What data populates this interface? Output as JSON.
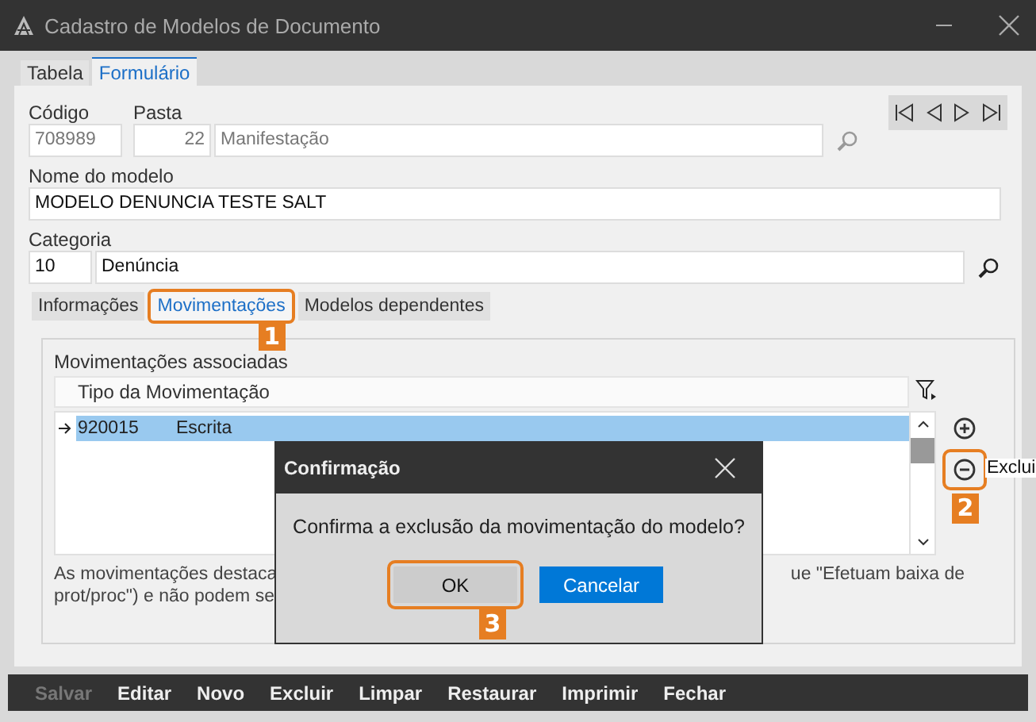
{
  "window": {
    "title": "Cadastro de Modelos de Documento"
  },
  "tabs": [
    {
      "label": "Tabela",
      "selected": false
    },
    {
      "label": "Formulário",
      "selected": true
    }
  ],
  "form": {
    "codigo_label": "Código",
    "codigo": "708989",
    "pasta_label": "Pasta",
    "pasta_code": "22",
    "pasta_name": "Manifestação",
    "nome_label": "Nome do modelo",
    "nome": "MODELO DENUNCIA TESTE SALT",
    "categoria_label": "Categoria",
    "categoria_code": "10",
    "categoria_name": "Denúncia"
  },
  "subtabs": [
    {
      "label": "Informações",
      "selected": false
    },
    {
      "label": "Movimentações",
      "selected": true
    },
    {
      "label": "Modelos dependentes",
      "selected": false
    }
  ],
  "grid": {
    "title": "Movimentações associadas",
    "column": "Tipo da Movimentação",
    "rows": [
      {
        "code": "920015",
        "name": "Escrita",
        "selected": true
      }
    ]
  },
  "tooltip": "Exclui",
  "note": {
    "left_lines": [
      "As movimentações destaca",
      "prot/proc\") e não podem se"
    ],
    "right_line": "ue \"Efetuam baixa de"
  },
  "dialog": {
    "title": "Confirmação",
    "message": "Confirma a exclusão da movimentação do modelo?",
    "buttons": [
      {
        "label": "OK",
        "kind": "default"
      },
      {
        "label": "Cancelar",
        "kind": "primary"
      }
    ]
  },
  "toolbar": [
    {
      "label": "Salvar",
      "disabled": true
    },
    {
      "label": "Editar",
      "disabled": false
    },
    {
      "label": "Novo",
      "disabled": false
    },
    {
      "label": "Excluir",
      "disabled": false
    },
    {
      "label": "Limpar",
      "disabled": false
    },
    {
      "label": "Restaurar",
      "disabled": false
    },
    {
      "label": "Imprimir",
      "disabled": false
    },
    {
      "label": "Fechar",
      "disabled": false
    }
  ],
  "callouts": [
    "1",
    "2",
    "3"
  ]
}
